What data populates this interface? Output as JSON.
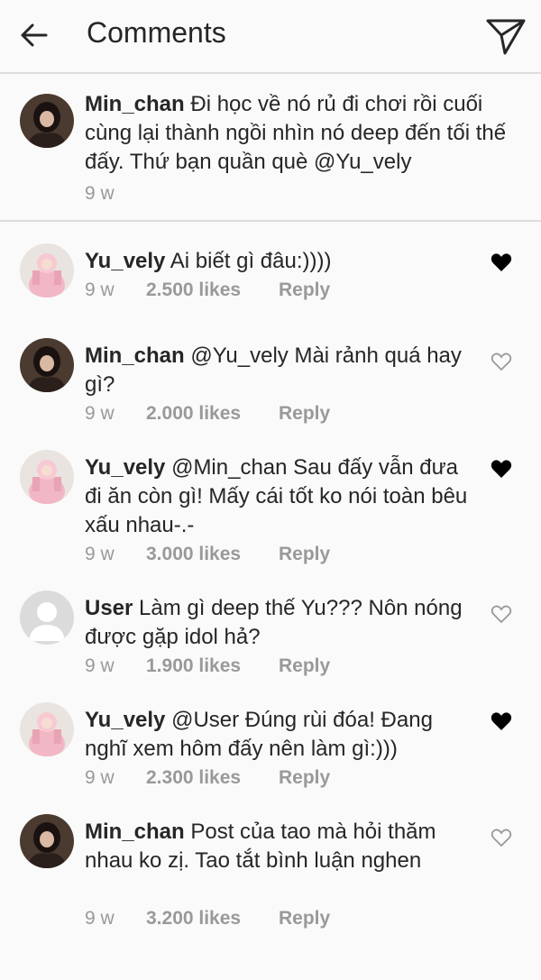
{
  "header": {
    "title": "Comments",
    "back_icon": "arrow-left-icon",
    "send_icon": "direct-send-icon"
  },
  "caption": {
    "username": "Min_chan",
    "text": "Đi học về nó rủ đi chơi rồi cuối cùng lại thành ngồi nhìn nó deep đến tối thế đấy. Thứ bạn quần què @Yu_vely",
    "time": "9 w"
  },
  "comments": [
    {
      "username": "Yu_vely",
      "text": "Ai biết gì đâu:))))",
      "time": "9 w",
      "likes": "2.500 likes",
      "reply": "Reply",
      "liked": true,
      "avatar": "pink-avatar"
    },
    {
      "username": "Min_chan",
      "text": "@Yu_vely Mài rảnh quá hay gì?",
      "time": "9 w",
      "likes": "2.000 likes",
      "reply": "Reply",
      "liked": false,
      "avatar": "dark-avatar"
    },
    {
      "username": "Yu_vely",
      "text": "@Min_chan Sau đấy vẫn đưa đi ăn còn gì! Mấy cái tốt ko nói toàn bêu xấu nhau-.-",
      "time": "9 w",
      "likes": "3.000 likes",
      "reply": "Reply",
      "liked": true,
      "avatar": "pink-avatar"
    },
    {
      "username": "User",
      "text": "Làm gì deep thế Yu??? Nôn nóng được gặp idol hả?",
      "time": "9 w",
      "likes": "1.900 likes",
      "reply": "Reply",
      "liked": false,
      "avatar": "default-avatar"
    },
    {
      "username": "Yu_vely",
      "text": "@User Đúng rùi đóa! Đang nghĩ xem hôm đấy nên làm gì:)))",
      "time": "9 w",
      "likes": "2.300 likes",
      "reply": "Reply",
      "liked": true,
      "avatar": "pink-avatar"
    },
    {
      "username": "Min_chan",
      "text": "Post của tao mà hỏi thăm nhau ko zị. Tao tắt bình luận nghen",
      "time": "9 w",
      "likes": "3.200 likes",
      "reply": "Reply",
      "liked": false,
      "avatar": "dark-avatar"
    }
  ],
  "colors": {
    "text": "#262626",
    "meta": "#999999",
    "divider": "#dcdcdc",
    "background": "#fafafa",
    "heart": "#000000"
  }
}
